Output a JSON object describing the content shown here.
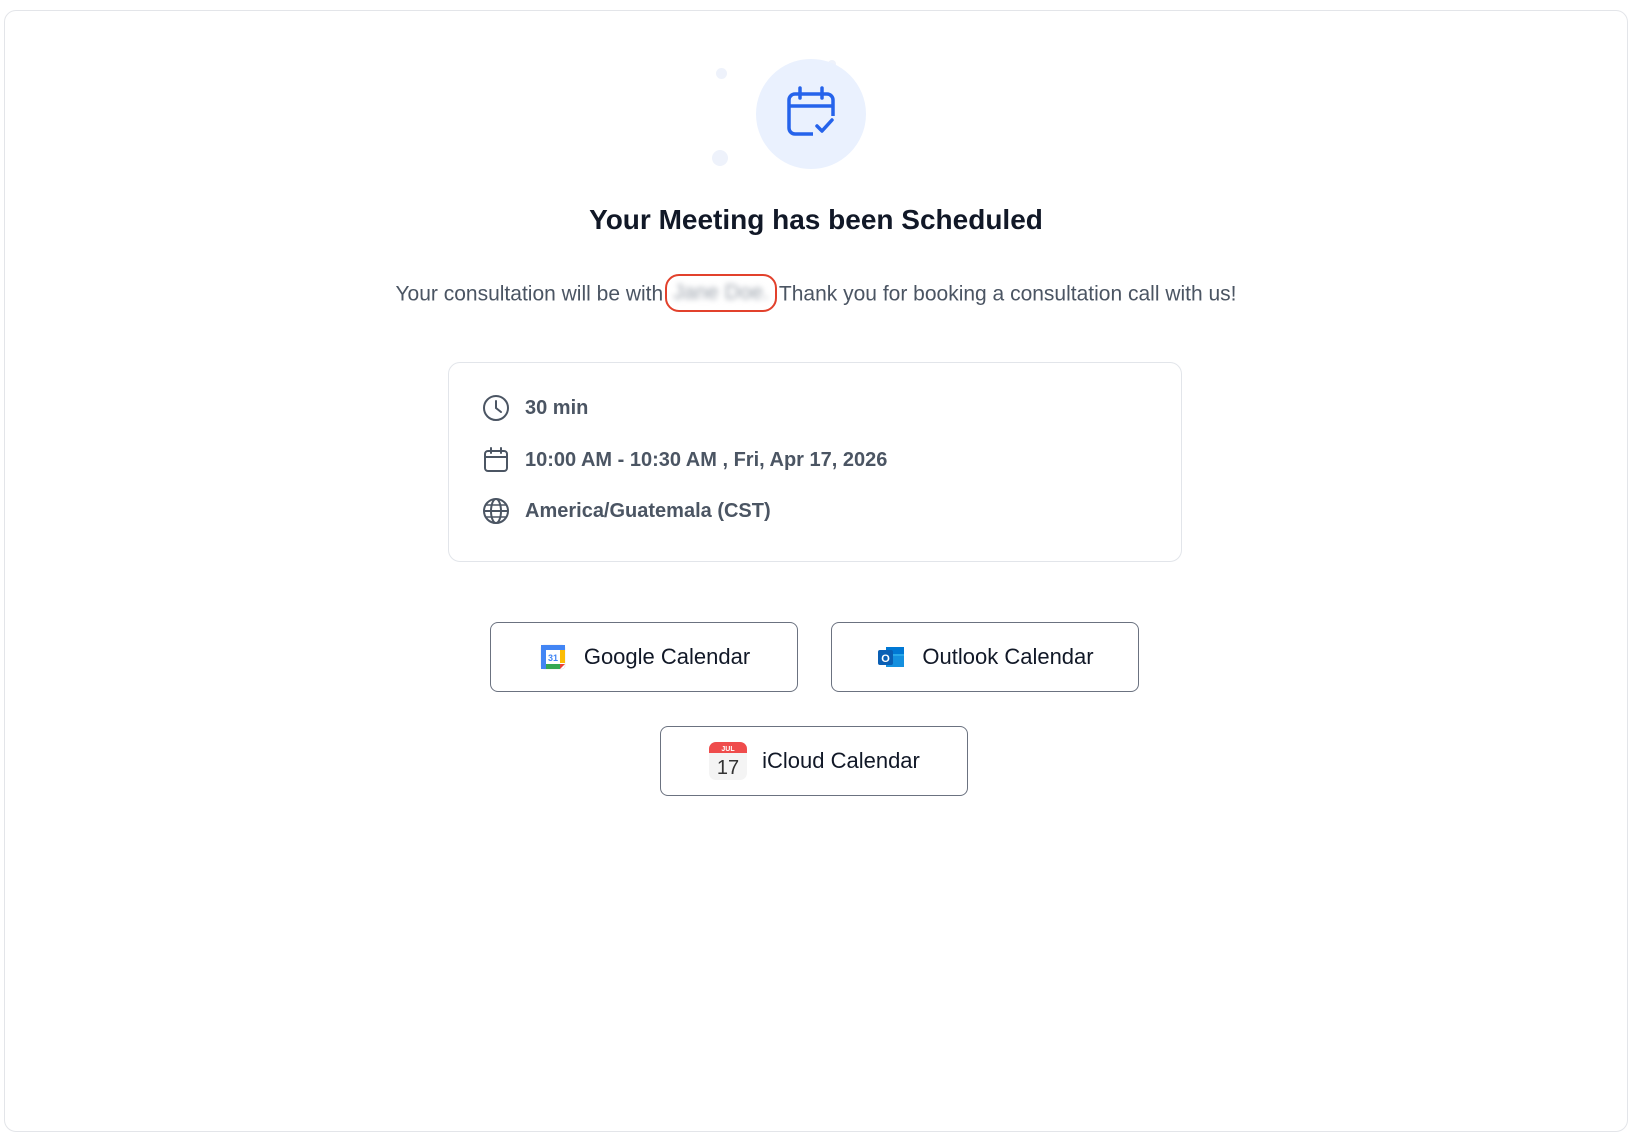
{
  "confirmation": {
    "title": "Your Meeting has been Scheduled",
    "message_prefix": "Your consultation will be with",
    "host_name": "Jane Doe.",
    "message_suffix": "Thank you for booking a consultation call with us!"
  },
  "details": {
    "duration": "30 min",
    "datetime": "10:00 AM - 10:30 AM , Fri, Apr 17, 2026",
    "timezone": "America/Guatemala (CST)"
  },
  "calendar_buttons": {
    "google": {
      "label": "Google Calendar",
      "icon": "google-calendar-icon",
      "icon_text": "31"
    },
    "outlook": {
      "label": "Outlook Calendar",
      "icon": "outlook-icon",
      "icon_text": "O"
    },
    "icloud": {
      "label": "iCloud Calendar",
      "icon": "icloud-calendar-icon",
      "icon_month": "JUL",
      "icon_day": "17"
    }
  },
  "colors": {
    "accent": "#2563eb",
    "highlight": "#e2412c",
    "text_muted": "#4b5563"
  }
}
